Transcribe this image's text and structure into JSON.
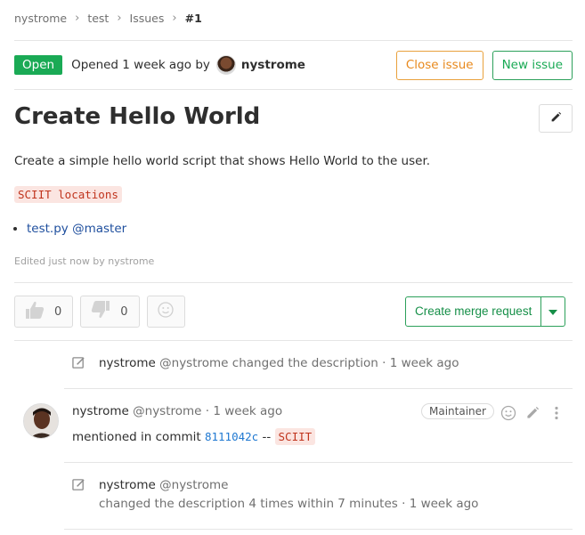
{
  "breadcrumb": [
    "nystrome",
    "test",
    "Issues",
    "#1"
  ],
  "issue": {
    "status": "Open",
    "opened_text": "Opened 1 week ago by",
    "author": "nystrome",
    "close_label": "Close issue",
    "new_label": "New issue",
    "title": "Create Hello World",
    "description": "Create a simple hello world script that shows Hello World to the user.",
    "label_code": "SCIIT locations",
    "files": [
      "test.py @master"
    ],
    "edited": "Edited just now by nystrome"
  },
  "awards": {
    "thumbs_up_count": "0",
    "thumbs_down_count": "0"
  },
  "merge": {
    "label": "Create merge request"
  },
  "notes": [
    {
      "author": "nystrome",
      "handle": "@nystrome",
      "text": "changed the description",
      "time": "· 1 week ago"
    },
    {
      "author": "nystrome",
      "handle": "@nystrome",
      "time": "· 1 week ago",
      "role": "Maintainer",
      "prefix": "mentioned in commit",
      "sha": "8111042c",
      "dashes": "--",
      "tag": "SCIIT"
    },
    {
      "author": "nystrome",
      "handle": "@nystrome",
      "text": "changed the description 4 times within 7 minutes",
      "time": "· 1 week ago"
    }
  ],
  "colors": {
    "success": "#1aaa55",
    "warning": "#e8891c",
    "link": "#1f78d1",
    "code_red": "#c0341d"
  }
}
